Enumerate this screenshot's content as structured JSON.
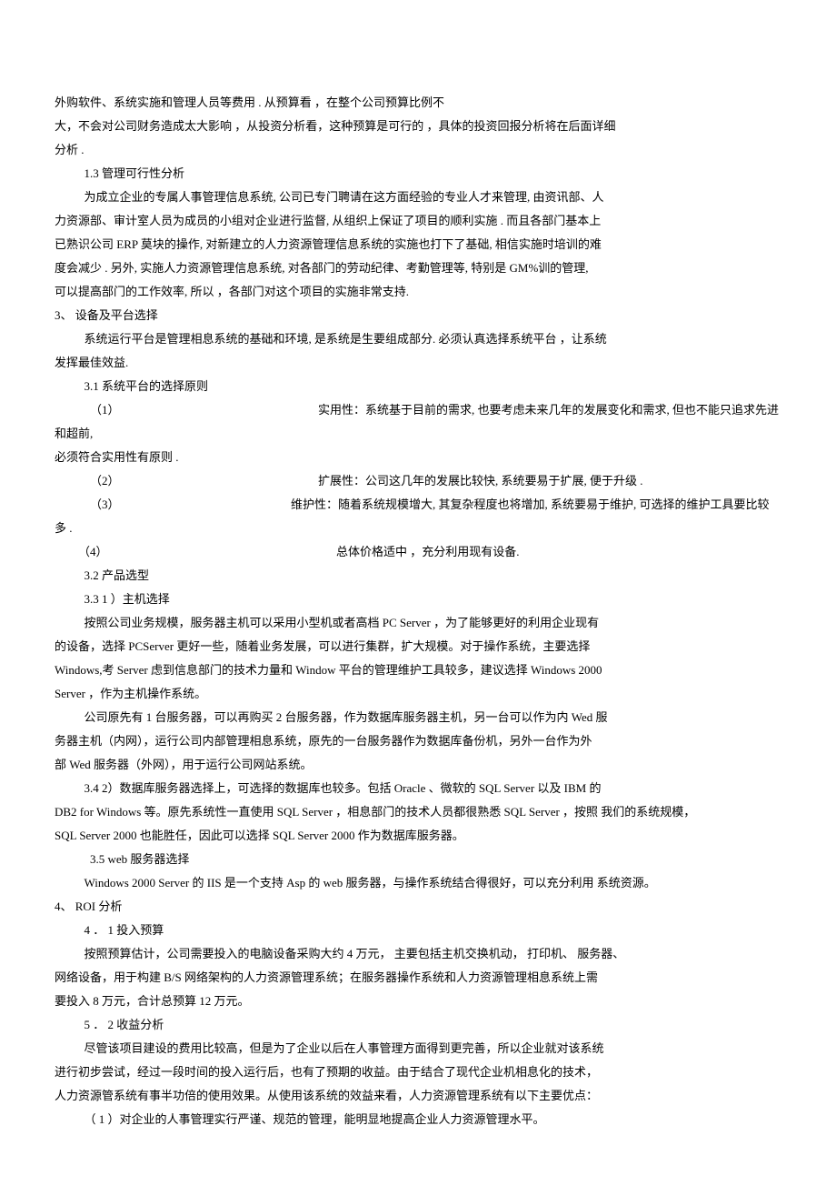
{
  "p1": "外购软件、系统实施和管理人员等费用 . 从预算看 ，在整个公司预算比例不",
  "p2": "大，不会对公司财务造成太大影响 ，从投资分析看，这种预算是可行的 ，具体的投资回报分析将在后面详细",
  "p3": "分析 .",
  "p4": "1.3 管理可行性分析",
  "p5": "为成立企业的专属人事管理信息系统, 公司已专门聘请在这方面经验的专业人才来管理, 由资讯部、人",
  "p6": "力资源部、审计室人员为成员的小组对企业进行监督, 从组织上保证了项目的顺利实施 . 而且各部门基本上",
  "p7": "已熟识公司 ERP 莫块的操作,  对新建立的人力资源管理信息系统的实施也打下了基础,  相信实施时培训的难",
  "p8": "度会减少 . 另外,  实施人力资源管理信息系统,  对各部门的劳动纪律、考勤管理等,  特别是 GM%训的管理,",
  "p9": "可以提高部门的工作效率, 所以 ，各部门对这个项目的实施非常支持.",
  "s3": "3、 设备及平台选择",
  "p10": "系统运行平台是管理相息系统的基础和环境, 是系统是生要组成部分. 必须认真选择系统平台 ，让系统",
  "p11": "发挥最佳效益.",
  "p12": "3.1  系统平台的选择原则",
  "i1n": "（1）",
  "i1t": "实用性：系统基于目前的需求, 也要考虑未来几年的发展变化和需求, 但也不能只追求先进",
  "p13": "和超前,",
  "p14": "必须符合实用性有原则 .",
  "i2n": "（2）",
  "i2t": "扩展性：公司这几年的发展比较快, 系统要易于扩展, 便于升级 .",
  "i3n": "（3）",
  "i3t": "维护性：随着系统规模增大, 其复杂程度也将增加, 系统要易于维护, 可选择的维护工具要比较",
  "p15": "多 .",
  "i4n": "（4）",
  "i4t": "总体价格适中 ，充分利用现有设备.",
  "p16": "3.2  产品选型",
  "p17": "3.3  1 ）主机选择",
  "p18": "按照公司业务规模，服务器主机可以采用小型机或者高档 PC Server ，为了能够更好的利用企业现有",
  "p19": "的设备，选择 PCServer 更好一些，随着业务发展，可以进行集群，扩大规模。对于操作系统，主要选择",
  "p20": "Windows,考 Server 虑到信息部门的技术力量和 Window 平台的管理维护工具较多，建议选择 Windows 2000",
  "p21": "Server ，作为主机操作系统。",
  "p22": "公司原先有 1 台服务器，可以再购买 2 台服务器，作为数据库服务器主机，另一台可以作为内 Wed 服",
  "p23": "务器主机（内网），运行公司内部管理相息系统，原先的一台服务器作为数据库备份机，另外一台作为外",
  "p24": "部 Wed 服务器（外网），用于运行公司网站系统。",
  "p25": "3.4  2）数据库服务器选择上，可选择的数据库也较多。包括 Oracle 、微软的 SQL Server 以及 IBM 的",
  "p26": "DB2 for Windows 等。原先系统性一直使用 SQL Server ，相息部门的技术人员都很熟悉 SQL Server ，按照 我们的系统规模，",
  "p27": "SQL Server 2000 也能胜任，因此可以选择 SQL Server 2000 作为数据库服务器。",
  "p28": "3.5   web 服务器选择",
  "p29": " Windows 2000 Server 的 IIS 是一个支持 Asp 的 web 服务器，与操作系统结合得很好，可以充分利用 系统资源。",
  "s4": "4、 ROI 分析",
  "p30": "4 ． 1 投入预算",
  "p31": "按照预算估计，公司需要投入的电脑设备采购大约 4 万元， 主要包括主机交换机动， 打印机、 服务器、",
  "p32": "网络设备，用于构建 B/S 网络架构的人力资源管理系统；在服务器操作系统和人力资源管理相息系统上需",
  "p33": "要投入 8 万元，合计总预算 12 万元。",
  "p34": "5 ． 2 收益分析",
  "p35": "尽管该项目建设的费用比较高，但是为了企业以后在人事管理方面得到更完善，所以企业就对该系统",
  "p36": "进行初步尝试，经过一段时间的投入运行后，也有了预期的收益。由于结合了现代企业机相息化的技术，",
  "p37": "人力资源管系统有事半功倍的使用效果。从使用该系统的效益来看，人力资源管理系统有以下主要优点：",
  "p38": "（ 1 ）对企业的人事管理实行严谨、规范的管理，能明显地提高企业人力资源管理水平。"
}
